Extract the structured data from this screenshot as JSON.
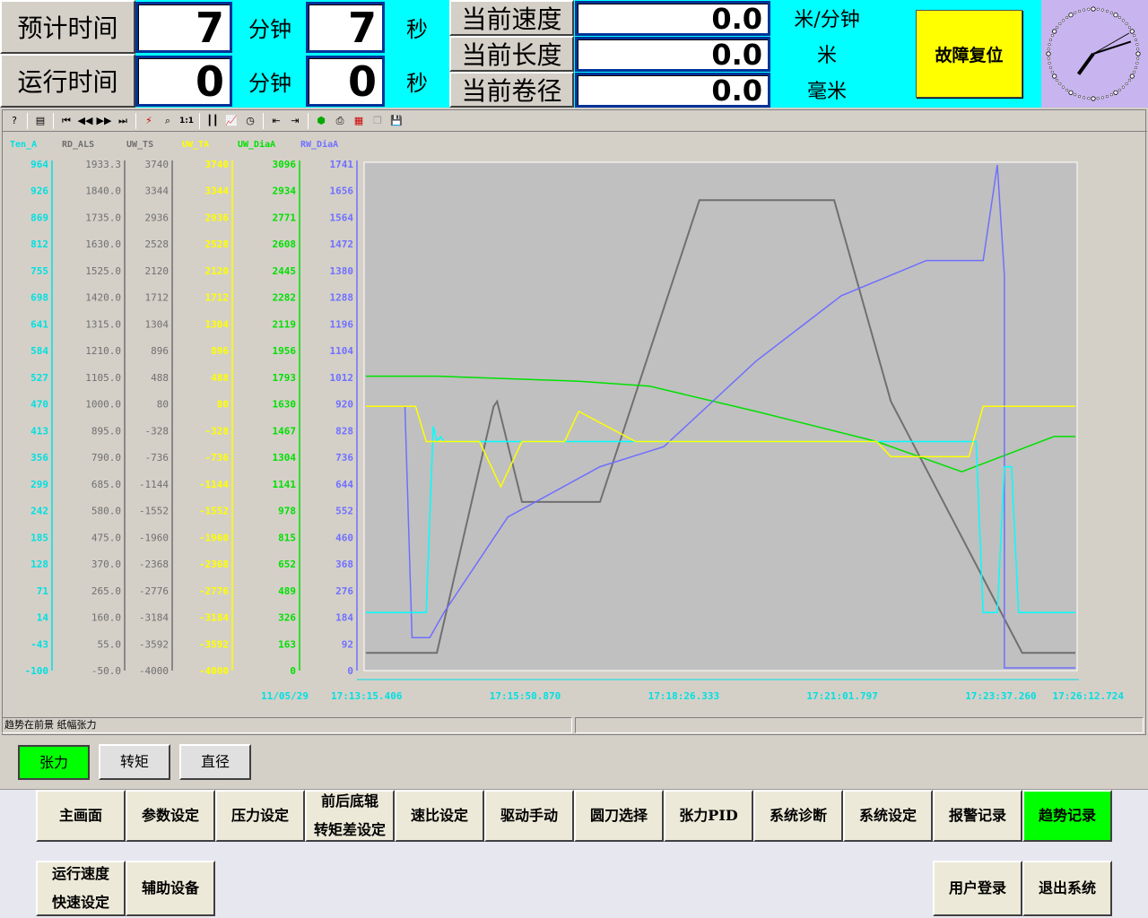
{
  "header": {
    "est_label": "预计时间",
    "run_label": "运行时间",
    "est_min": "7",
    "est_sec": "7",
    "run_min": "0",
    "run_sec": "0",
    "min_unit": "分钟",
    "sec_unit": "秒",
    "speed_label": "当前速度",
    "length_label": "当前长度",
    "dia_label": "当前卷径",
    "speed_value": "0.0",
    "length_value": "0.0",
    "dia_value": "0.0",
    "speed_unit": "米/分钟",
    "length_unit": "米",
    "dia_unit": "毫米",
    "fault_reset": "故障复位"
  },
  "toolbar": {
    "icons": [
      "help-icon",
      "list-icon",
      "first-icon",
      "rewind-icon",
      "forward-icon",
      "last-icon",
      "split-icon",
      "zoom-icon",
      "actual-size-icon",
      "bars-icon",
      "line-chart-icon",
      "clock-icon",
      "import-icon",
      "export-icon",
      "settings-icon",
      "print-icon",
      "chart-icon",
      "copy-icon",
      "save-icon"
    ],
    "zoom_ratio": "1:1"
  },
  "status": {
    "left": "趋势在前景 纸幅张力",
    "right": ""
  },
  "mode_tabs": [
    {
      "label": "张力",
      "active": true
    },
    {
      "label": "转矩",
      "active": false
    },
    {
      "label": "直径",
      "active": false
    }
  ],
  "nav": {
    "row1": [
      "主画面",
      "参数设定",
      "压力设定",
      "前后底辊|转矩差设定",
      "速比设定",
      "驱动手动",
      "圆刀选择",
      "张力PID",
      "系统诊断",
      "系统设定",
      "报警记录",
      "趋势记录"
    ],
    "active": "趋势记录",
    "row2_left": [
      "运行速度|快速设定",
      "辅助设备"
    ],
    "row2_right": [
      "用户登录",
      "退出系统"
    ]
  },
  "clock": {
    "hour": 7,
    "minute": 12
  },
  "chart_data": {
    "type": "line",
    "date": "11/05/29",
    "x_ticks": [
      "17:13:15.406",
      "17:15:50.870",
      "17:18:26.333",
      "17:21:01.797",
      "17:23:37.260",
      "17:26:12.724"
    ],
    "axes": [
      {
        "name": "Ten_A",
        "color": "#00e0e0",
        "ticks": [
          "964",
          "926",
          "869",
          "812",
          "755",
          "698",
          "641",
          "584",
          "527",
          "470",
          "413",
          "356",
          "299",
          "242",
          "185",
          "128",
          "71",
          "14",
          "-43",
          "-100"
        ]
      },
      {
        "name": "RD_ALS",
        "color": "#707070",
        "ticks": [
          "1933.3",
          "1840.0",
          "1735.0",
          "1630.0",
          "1525.0",
          "1420.0",
          "1315.0",
          "1210.0",
          "1105.0",
          "1000.0",
          "895.0",
          "790.0",
          "685.0",
          "580.0",
          "475.0",
          "370.0",
          "265.0",
          "160.0",
          "55.0",
          "-50.0"
        ]
      },
      {
        "name": "UW_TS",
        "color": "#707070",
        "ticks": [
          "3740",
          "3344",
          "2936",
          "2528",
          "2120",
          "1712",
          "1304",
          "896",
          "488",
          "80",
          "-328",
          "-736",
          "-1144",
          "-1552",
          "-1960",
          "-2368",
          "-2776",
          "-3184",
          "-3592",
          "-4000"
        ]
      },
      {
        "name": "UW_TA",
        "color": "#ffff00",
        "ticks": [
          "3740",
          "3344",
          "2936",
          "2528",
          "2120",
          "1712",
          "1304",
          "896",
          "488",
          "80",
          "-328",
          "-736",
          "-1144",
          "-1552",
          "-1960",
          "-2368",
          "-2776",
          "-3184",
          "-3592",
          "-4000"
        ]
      },
      {
        "name": "UW_DiaA",
        "color": "#00e000",
        "ticks": [
          "3096",
          "2934",
          "2771",
          "2608",
          "2445",
          "2282",
          "2119",
          "1956",
          "1793",
          "1630",
          "1467",
          "1304",
          "1141",
          "978",
          "815",
          "652",
          "489",
          "326",
          "163",
          "0"
        ]
      },
      {
        "name": "RW_DiaA",
        "color": "#7070ff",
        "ticks": [
          "1741",
          "1656",
          "1564",
          "1472",
          "1380",
          "1288",
          "1196",
          "1104",
          "1012",
          "920",
          "828",
          "736",
          "644",
          "552",
          "460",
          "368",
          "276",
          "184",
          "92",
          "0"
        ]
      }
    ],
    "series": [
      {
        "color": "#707070",
        "t": [
          0,
          0.1,
          0.18,
          0.185,
          0.22,
          0.24,
          0.33,
          0.47,
          0.66,
          0.74,
          0.925,
          0.96,
          1
        ],
        "level": [
          0.03,
          0.03,
          0.52,
          0.53,
          0.33,
          0.33,
          0.33,
          0.93,
          0.93,
          0.53,
          0.03,
          0.03,
          0.03
        ]
      },
      {
        "color": "#00e000",
        "t": [
          0,
          0.1,
          0.3,
          0.4,
          0.55,
          0.72,
          0.84,
          0.97,
          1
        ],
        "level": [
          0.58,
          0.58,
          0.57,
          0.56,
          0.51,
          0.45,
          0.39,
          0.46,
          0.46
        ]
      },
      {
        "color": "#6f6fff",
        "t": [
          0,
          0.055,
          0.065,
          0.09,
          0.11,
          0.2,
          0.33,
          0.42,
          0.55,
          0.67,
          0.79,
          0.87,
          0.89,
          0.9,
          0.9,
          1
        ],
        "level": [
          0.52,
          0.52,
          0.06,
          0.06,
          0.11,
          0.3,
          0.4,
          0.44,
          0.61,
          0.74,
          0.81,
          0.81,
          1,
          0.78,
          0.0,
          0.0
        ]
      },
      {
        "color": "#00ffff",
        "t": [
          0,
          0.085,
          0.095,
          0.1,
          0.105,
          0.11,
          0.2,
          0.45,
          0.73,
          0.86,
          0.87,
          0.89,
          0.9,
          0.91,
          0.92,
          1
        ],
        "level": [
          0.11,
          0.11,
          0.48,
          0.45,
          0.46,
          0.45,
          0.45,
          0.45,
          0.45,
          0.45,
          0.11,
          0.11,
          0.4,
          0.4,
          0.11,
          0.11
        ]
      },
      {
        "color": "#ffff00",
        "t": [
          0,
          0.07,
          0.085,
          0.1,
          0.16,
          0.19,
          0.22,
          0.28,
          0.3,
          0.38,
          0.46,
          0.72,
          0.74,
          0.85,
          0.87,
          0.89,
          1
        ],
        "level": [
          0.52,
          0.52,
          0.45,
          0.45,
          0.45,
          0.36,
          0.45,
          0.45,
          0.51,
          0.45,
          0.45,
          0.45,
          0.42,
          0.42,
          0.52,
          0.52,
          0.52
        ]
      }
    ]
  }
}
